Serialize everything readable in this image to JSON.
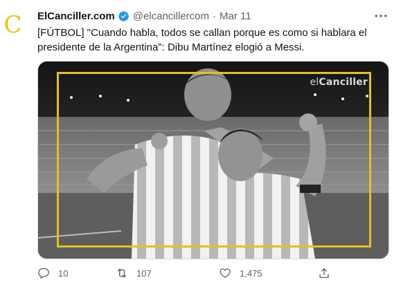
{
  "account": {
    "name": "ElCanciller.com",
    "handle": "@elcancillercom",
    "separator": "·",
    "date": "Mar 11",
    "avatar_letter": "C",
    "avatar_color": "#e4c21a"
  },
  "tweet": {
    "text": "[FÚTBOL] \"Cuando habla, todos se callan porque es como si hablara el presidente de la Argentina\": Dibu Martínez elogió a Messi."
  },
  "media": {
    "watermark_prefix": "el",
    "watermark_bold": "Canciller",
    "frame_color": "#e4c21a"
  },
  "actions": {
    "reply": {
      "icon": "reply-icon",
      "count": "10"
    },
    "retweet": {
      "icon": "retweet-icon",
      "count": "107"
    },
    "like": {
      "icon": "like-icon",
      "count": "1,475"
    },
    "share": {
      "icon": "share-icon"
    }
  },
  "colors": {
    "verified": "#1d9bf0",
    "secondary_text": "#536471"
  }
}
